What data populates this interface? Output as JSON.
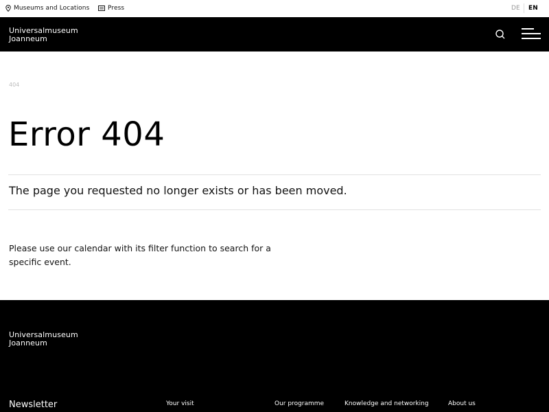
{
  "topbar": {
    "museums_label": "Museums and Locations",
    "press_label": "Press",
    "lang_de": "DE",
    "lang_en": "EN"
  },
  "header": {
    "logo_line1": "Universalmuseum",
    "logo_line2": "Joanneum",
    "icons": [
      "search-icon",
      "menu-icon"
    ]
  },
  "main": {
    "breadcrumb": "404",
    "title": "Error 404",
    "lead": "The page you requested no longer exists or has been moved.",
    "body": "Please use our calendar with its filter function to search for a specific event."
  },
  "footer": {
    "logo_line1": "Universalmuseum",
    "logo_line2": "Joanneum",
    "newsletter": "Newsletter",
    "nav": [
      "Your visit",
      "Our programme",
      "Knowledge and networking",
      "About us"
    ]
  },
  "colors": {
    "header_bg": "#000000",
    "footer_bg": "#000000",
    "divider": "#e2e2e2",
    "breadcrumb": "#bbbbbb"
  }
}
